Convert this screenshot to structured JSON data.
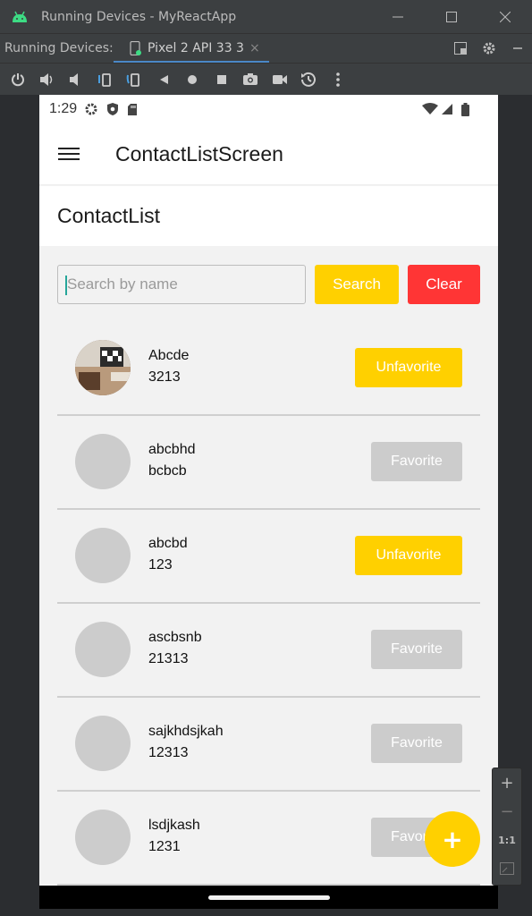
{
  "window": {
    "title": "Running Devices - MyReactApp"
  },
  "tabs": {
    "label": "Running Devices:",
    "device_tab": "Pixel 2 API 33 3",
    "close": "×"
  },
  "status_bar": {
    "time": "1:29"
  },
  "app_bar": {
    "title": "ContactListScreen"
  },
  "page": {
    "title": "ContactList"
  },
  "search": {
    "placeholder": "Search by name",
    "value": "",
    "search_label": "Search",
    "clear_label": "Clear"
  },
  "contacts": [
    {
      "name": "Abcde",
      "phone": "3213",
      "button": "Unfavorite",
      "favorite": true,
      "has_photo": true
    },
    {
      "name": "abcbhd",
      "phone": "bcbcb",
      "button": "Favorite",
      "favorite": false,
      "has_photo": false
    },
    {
      "name": "abcbd",
      "phone": "123",
      "button": "Unfavorite",
      "favorite": true,
      "has_photo": false
    },
    {
      "name": "ascbsnb",
      "phone": "21313",
      "button": "Favorite",
      "favorite": false,
      "has_photo": false
    },
    {
      "name": "sajkhdsjkah",
      "phone": "12313",
      "button": "Favorite",
      "favorite": false,
      "has_photo": false
    },
    {
      "name": "lsdjkash",
      "phone": "1231",
      "button": "Favorite",
      "favorite": false,
      "has_photo": false
    }
  ],
  "fab": {
    "label": "+"
  },
  "zoom_panel": {
    "plus": "+",
    "minus": "−",
    "one_to_one": "1:1"
  },
  "colors": {
    "accent_yellow": "#ffd000",
    "clear_red": "#ff3535",
    "disabled_gray": "#cccccc"
  }
}
